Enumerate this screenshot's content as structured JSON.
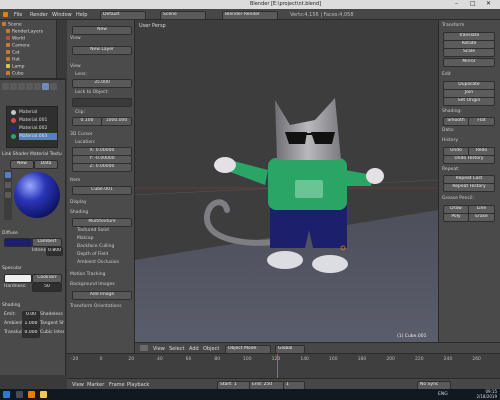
{
  "window": {
    "title": "Blender [E:\\project\\nt.blend]",
    "controls": [
      "–",
      "□",
      "✕"
    ]
  },
  "menubar": {
    "items": [
      "File",
      "Render",
      "Window",
      "Help"
    ],
    "layout_label": "Default",
    "scene_label": "Scene",
    "engine_label": "Blender Render",
    "stats": "Verts:4,156 | Faces:4,058"
  },
  "outliner": {
    "rows": [
      "Scene",
      "RenderLayers",
      "World",
      "Camera",
      "Cat",
      "Hat",
      "Lamp",
      "Cube"
    ]
  },
  "properties": {
    "tabs_row": "Link  Shader  Material  Texture",
    "material_slots": [
      "Material",
      "Material.001",
      "Material.002",
      "Material.003"
    ],
    "buttons": {
      "new": "New",
      "data": "Data"
    },
    "diffuse_label": "Diffuse",
    "lambert": "Lambert",
    "intensity_label": "Intensity:",
    "intensity_value": "0.800",
    "specular_label": "Specular",
    "cooktorr": "CookTorr",
    "hardness_label": "Hardness:",
    "hardness_value": "50",
    "shading_label": "Shading",
    "emit_label": "Emit:",
    "emit_value": "0.00",
    "ambient_label": "Ambient:",
    "ambient_value": "1.000",
    "translucency_label": "Translucency:",
    "translucency_value": "0.000",
    "shadeless_label": "Shadeless",
    "tangent_label": "Tangent Shading",
    "cubic_label": "Cubic Interpolation"
  },
  "tools": {
    "header_view": "View",
    "new_label": "New",
    "new_layer": "New Layer",
    "view_label": "View",
    "lens_label": "Lens:",
    "lens_value": "35.000",
    "lock_label": "Lock to Object:",
    "clip_label": "Clip:",
    "clip_start": "0.100",
    "clip_end": "1000.000",
    "cursor_label": "3D Cursor",
    "location_label": "Location:",
    "cursor_x": "X: 0.00000",
    "cursor_y": "Y: -0.00000",
    "cursor_z": "Z: 0.00000",
    "item_label": "Item",
    "cube_value": "Cube.001",
    "display_label": "Display",
    "shading_label": "Shading",
    "multitexture": "Multitexture",
    "textured_solid": "Textured Solid",
    "matcap": "Matcap",
    "backface_culling": "Backface Culling",
    "depth_of_field": "Depth of Field",
    "ambient_occlusion": "Ambient Occlusion",
    "motion_tracking": "Motion Tracking",
    "background_images": "Background Images",
    "add_image": "Add Image",
    "transform_orientations": "Transform Orientations"
  },
  "viewport": {
    "label": "User Persp",
    "object_label": "(1) Cube.001"
  },
  "right_panel": {
    "header": "Transform",
    "buttons": [
      "Translate",
      "Rotate",
      "Scale",
      "Mirror"
    ],
    "edit_label": "Edit",
    "edit_buttons": [
      "Duplicate",
      "Join",
      "Set Origin"
    ],
    "history_label": "History",
    "history_buttons": [
      "Undo",
      "Redo",
      "Undo History"
    ],
    "smooth_label": "Shading:",
    "smooth_flat": [
      "Smooth",
      "Flat"
    ],
    "data_label": "Data:",
    "grease_label": "Grease Pencil:",
    "grease_buttons": [
      "Draw",
      "Line",
      "Poly",
      "Erase"
    ],
    "repeat_label": "Repeat:",
    "repeat_buttons": [
      "Repeat Last",
      "Repeat History"
    ]
  },
  "vp_header": {
    "items": [
      "View",
      "Select",
      "Add",
      "Object",
      "Object Mode",
      "Global"
    ]
  },
  "timeline": {
    "ticks": [
      "-20",
      "0",
      "20",
      "40",
      "60",
      "80",
      "100",
      "120",
      "140",
      "160",
      "180",
      "200",
      "220",
      "240",
      "260"
    ],
    "header_items": [
      "View",
      "Marker",
      "Frame",
      "Playback"
    ],
    "start_label": "Start: 1",
    "end_label": "End: 250",
    "frame_value": "1",
    "no_sync": "No Sync"
  },
  "taskbar": {
    "clock_time": "09:15",
    "clock_date": "2/18/2019",
    "lang": "ENG"
  },
  "colors": {
    "accent": "#5680c2",
    "shirt": "#2aa565",
    "pants": "#1c1f6b",
    "body": "#a7a7ab"
  }
}
